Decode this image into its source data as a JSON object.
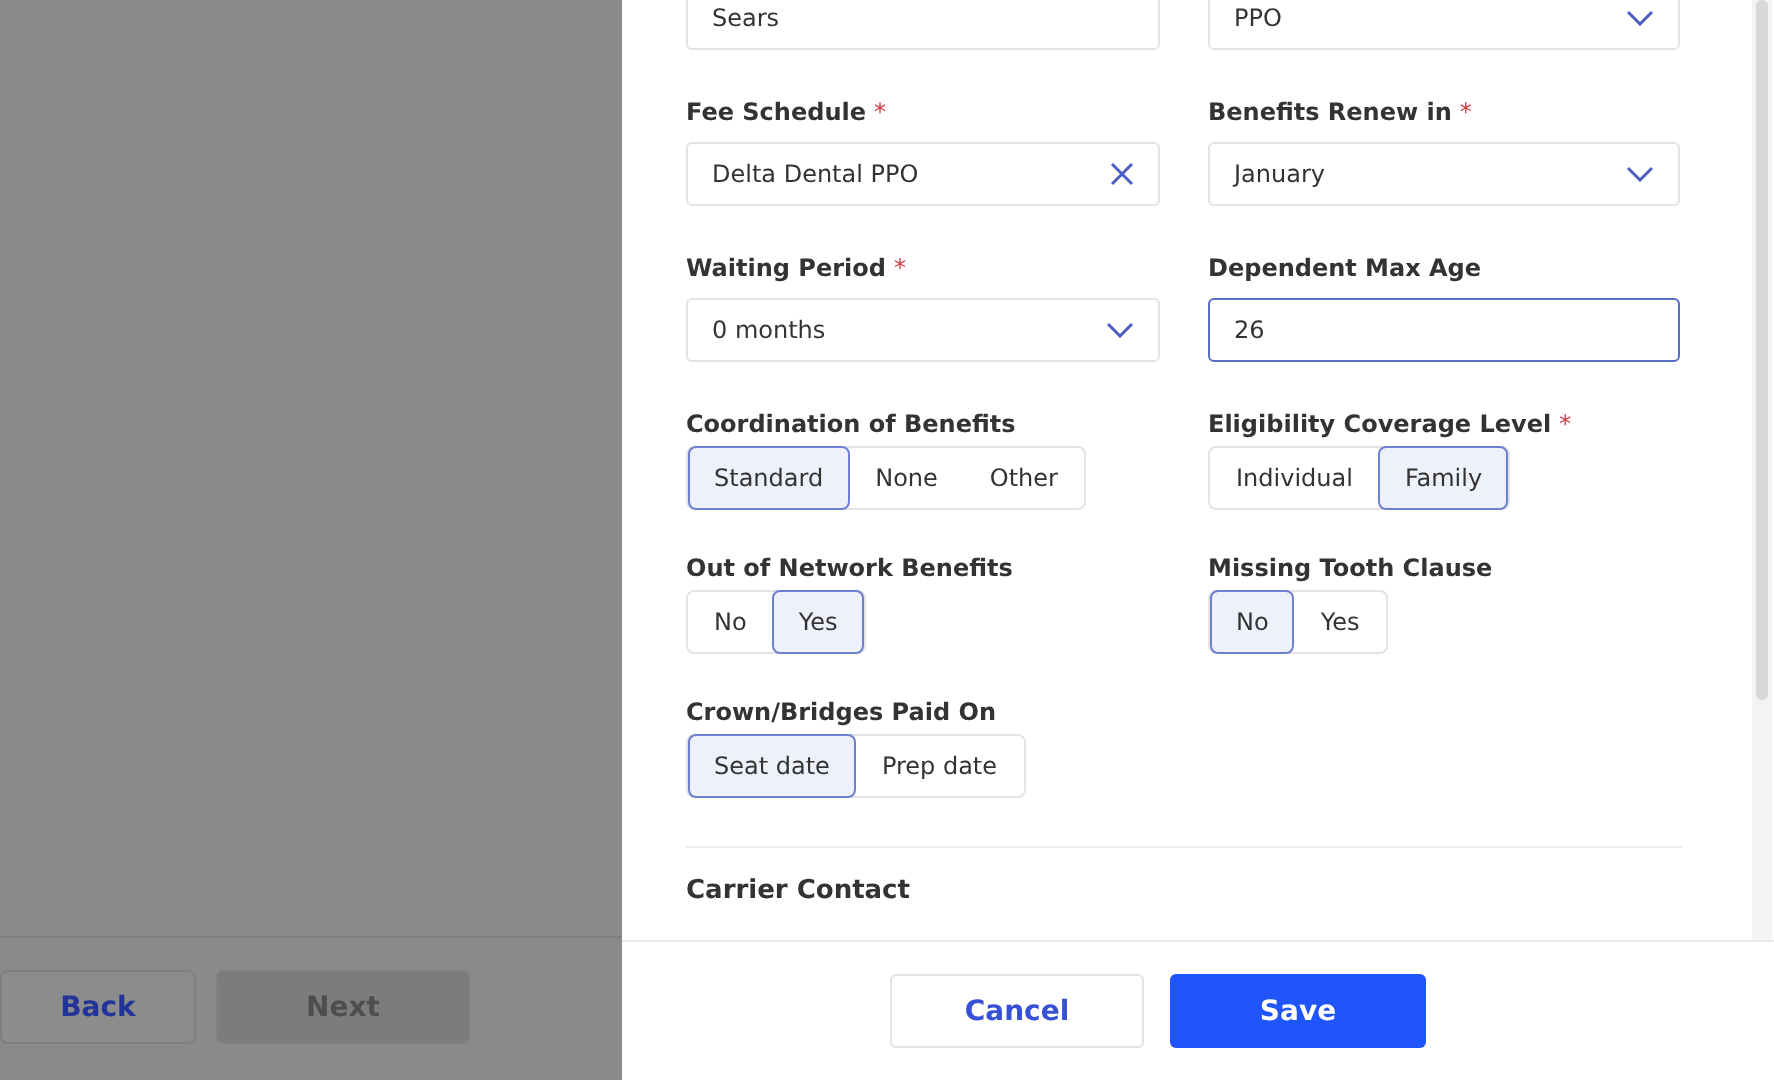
{
  "background_page": {
    "buttons": [
      {
        "label": "Back",
        "kind": "link"
      },
      {
        "label": "Next",
        "kind": "disabled"
      }
    ]
  },
  "drawer": {
    "fields": [
      {
        "kind": "text",
        "value": "Sears"
      },
      {
        "kind": "select",
        "value": "PPO"
      },
      {
        "kind": "clearable",
        "label": "Fee Schedule",
        "required_mark": "*",
        "value": "Delta Dental PPO"
      },
      {
        "kind": "select",
        "label": "Benefits Renew in",
        "required_mark": "*",
        "value": "January"
      },
      {
        "kind": "select",
        "label": "Waiting Period",
        "required_mark": "*",
        "value": "0 months"
      },
      {
        "kind": "input",
        "label": "Dependent Max Age",
        "value": "26",
        "focused": true
      },
      {
        "kind": "segmented",
        "label": "Coordination of Benefits",
        "options": [
          {
            "label": "Standard",
            "selected": true
          },
          {
            "label": "None",
            "selected": false
          },
          {
            "label": "Other",
            "selected": false
          }
        ]
      },
      {
        "kind": "segmented",
        "label": "Eligibility Coverage Level",
        "required_mark": "*",
        "options": [
          {
            "label": "Individual",
            "selected": false
          },
          {
            "label": "Family",
            "selected": true
          }
        ]
      },
      {
        "kind": "segmented",
        "label": "Out of Network Benefits",
        "options": [
          {
            "label": "No",
            "selected": false
          },
          {
            "label": "Yes",
            "selected": true
          }
        ]
      },
      {
        "kind": "segmented",
        "label": "Missing Tooth Clause",
        "options": [
          {
            "label": "No",
            "selected": true
          },
          {
            "label": "Yes",
            "selected": false
          }
        ]
      },
      {
        "kind": "segmented",
        "label": "Crown/Bridges Paid On",
        "options": [
          {
            "label": "Seat date",
            "selected": true
          },
          {
            "label": "Prep date",
            "selected": false
          }
        ]
      }
    ],
    "section_title": "Carrier Contact",
    "footer": {
      "cancel": "Cancel",
      "save": "Save"
    }
  }
}
